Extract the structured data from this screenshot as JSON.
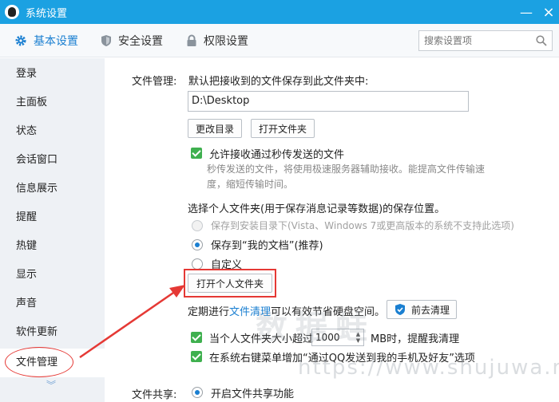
{
  "window": {
    "title": "系统设置",
    "minimize": "—",
    "close": "×"
  },
  "topnav": {
    "tabs": [
      {
        "label": "基本设置",
        "icon": "gear-icon"
      },
      {
        "label": "安全设置",
        "icon": "shield-icon"
      },
      {
        "label": "权限设置",
        "icon": "lock-icon"
      }
    ],
    "search_placeholder": "搜索设置项"
  },
  "sidebar": {
    "items": [
      "登录",
      "主面板",
      "状态",
      "会话窗口",
      "信息展示",
      "提醒",
      "热键",
      "显示",
      "声音",
      "软件更新",
      "文件管理"
    ],
    "active": "文件管理"
  },
  "file_mgmt": {
    "section_label": "文件管理:",
    "save_desc": "默认把接收到的文件保存到此文件夹中:",
    "path_value": "D:\\Desktop",
    "change_dir_button": "更改目录",
    "open_folder_button": "打开文件夹",
    "allow_fast_transfer": "允许接收通过秒传发送的文件",
    "fast_transfer_desc_1": "秒传发送的文件，将使用极速服务器辅助接收。能提高文件传输速",
    "fast_transfer_desc_2": "度，缩短传输时间。",
    "personal_folder_desc": "选择个人文件夹(用于保存消息记录等数据)的保存位置。",
    "radio_install_dir": "保存到安装目录下(Vista、Windows 7或更高版本的系统不支持此选项)",
    "radio_my_docs": "保存到“我的文档”(推荐)",
    "radio_custom": "自定义",
    "open_personal_folder_button": "打开个人文件夹",
    "cleanup_prefix": "定期进行",
    "cleanup_link": "文件清理",
    "cleanup_suffix": "可以有效节省硬盘空间。",
    "go_cleanup_button": "前去清理",
    "size_warn_prefix": "当个人文件夹大小超过",
    "size_value": "1000",
    "size_warn_suffix": "MB时，提醒我清理",
    "context_menu_option": "在系统右键菜单增加“通过QQ发送到我的手机及好友”选项"
  },
  "file_share": {
    "section_label": "文件共享:",
    "enable_label": "开启文件共享功能"
  },
  "watermark": {
    "text": "数据蛙",
    "url": "https://www.shujuwa.net"
  },
  "colors": {
    "titlebar": "#1ba1e2",
    "accent": "#1a7fd1",
    "check": "#3fb04f",
    "annotation": "#e53935"
  }
}
